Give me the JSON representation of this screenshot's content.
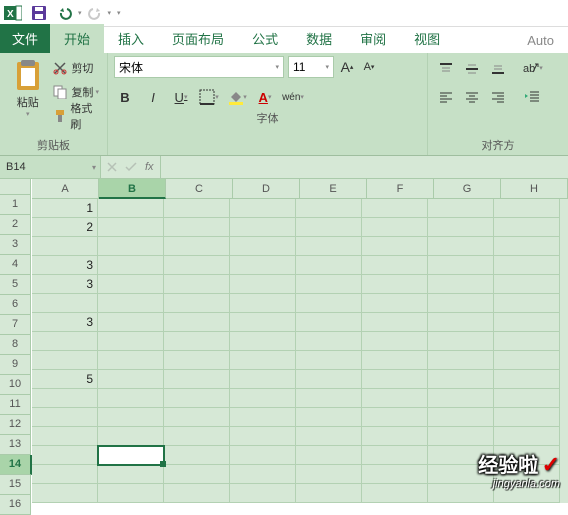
{
  "titlebar": {
    "undo_dd": "▾",
    "redo_dd": "▾",
    "customize_dd": "▾"
  },
  "tabs": {
    "file": "文件",
    "home": "开始",
    "insert": "插入",
    "layout": "页面布局",
    "formulas": "公式",
    "data": "数据",
    "review": "审阅",
    "view": "视图",
    "auto": "Auto"
  },
  "clipboard": {
    "paste": "粘贴",
    "cut": "剪切",
    "copy": "复制",
    "format_painter": "格式刷",
    "group_label": "剪贴板"
  },
  "font": {
    "name": "宋体",
    "size": "11",
    "increase": "A",
    "decrease": "A",
    "bold": "B",
    "italic": "I",
    "underline": "U",
    "wen": "wén",
    "group_label": "字体"
  },
  "align": {
    "group_label": "对齐方"
  },
  "namebox": "B14",
  "fx_label": "fx",
  "columns": [
    "A",
    "B",
    "C",
    "D",
    "E",
    "F",
    "G",
    "H"
  ],
  "rows": [
    "1",
    "2",
    "3",
    "4",
    "5",
    "6",
    "7",
    "8",
    "9",
    "10",
    "11",
    "12",
    "13",
    "14",
    "15",
    "16"
  ],
  "cells": {
    "A1": "1",
    "A2": "2",
    "A4": "3",
    "A5": "3",
    "A7": "3",
    "A10": "5"
  },
  "selected": {
    "col": "B",
    "row": "14"
  },
  "watermark": {
    "big": "经验啦",
    "url": "jingyanla.com"
  },
  "chart_data": null
}
